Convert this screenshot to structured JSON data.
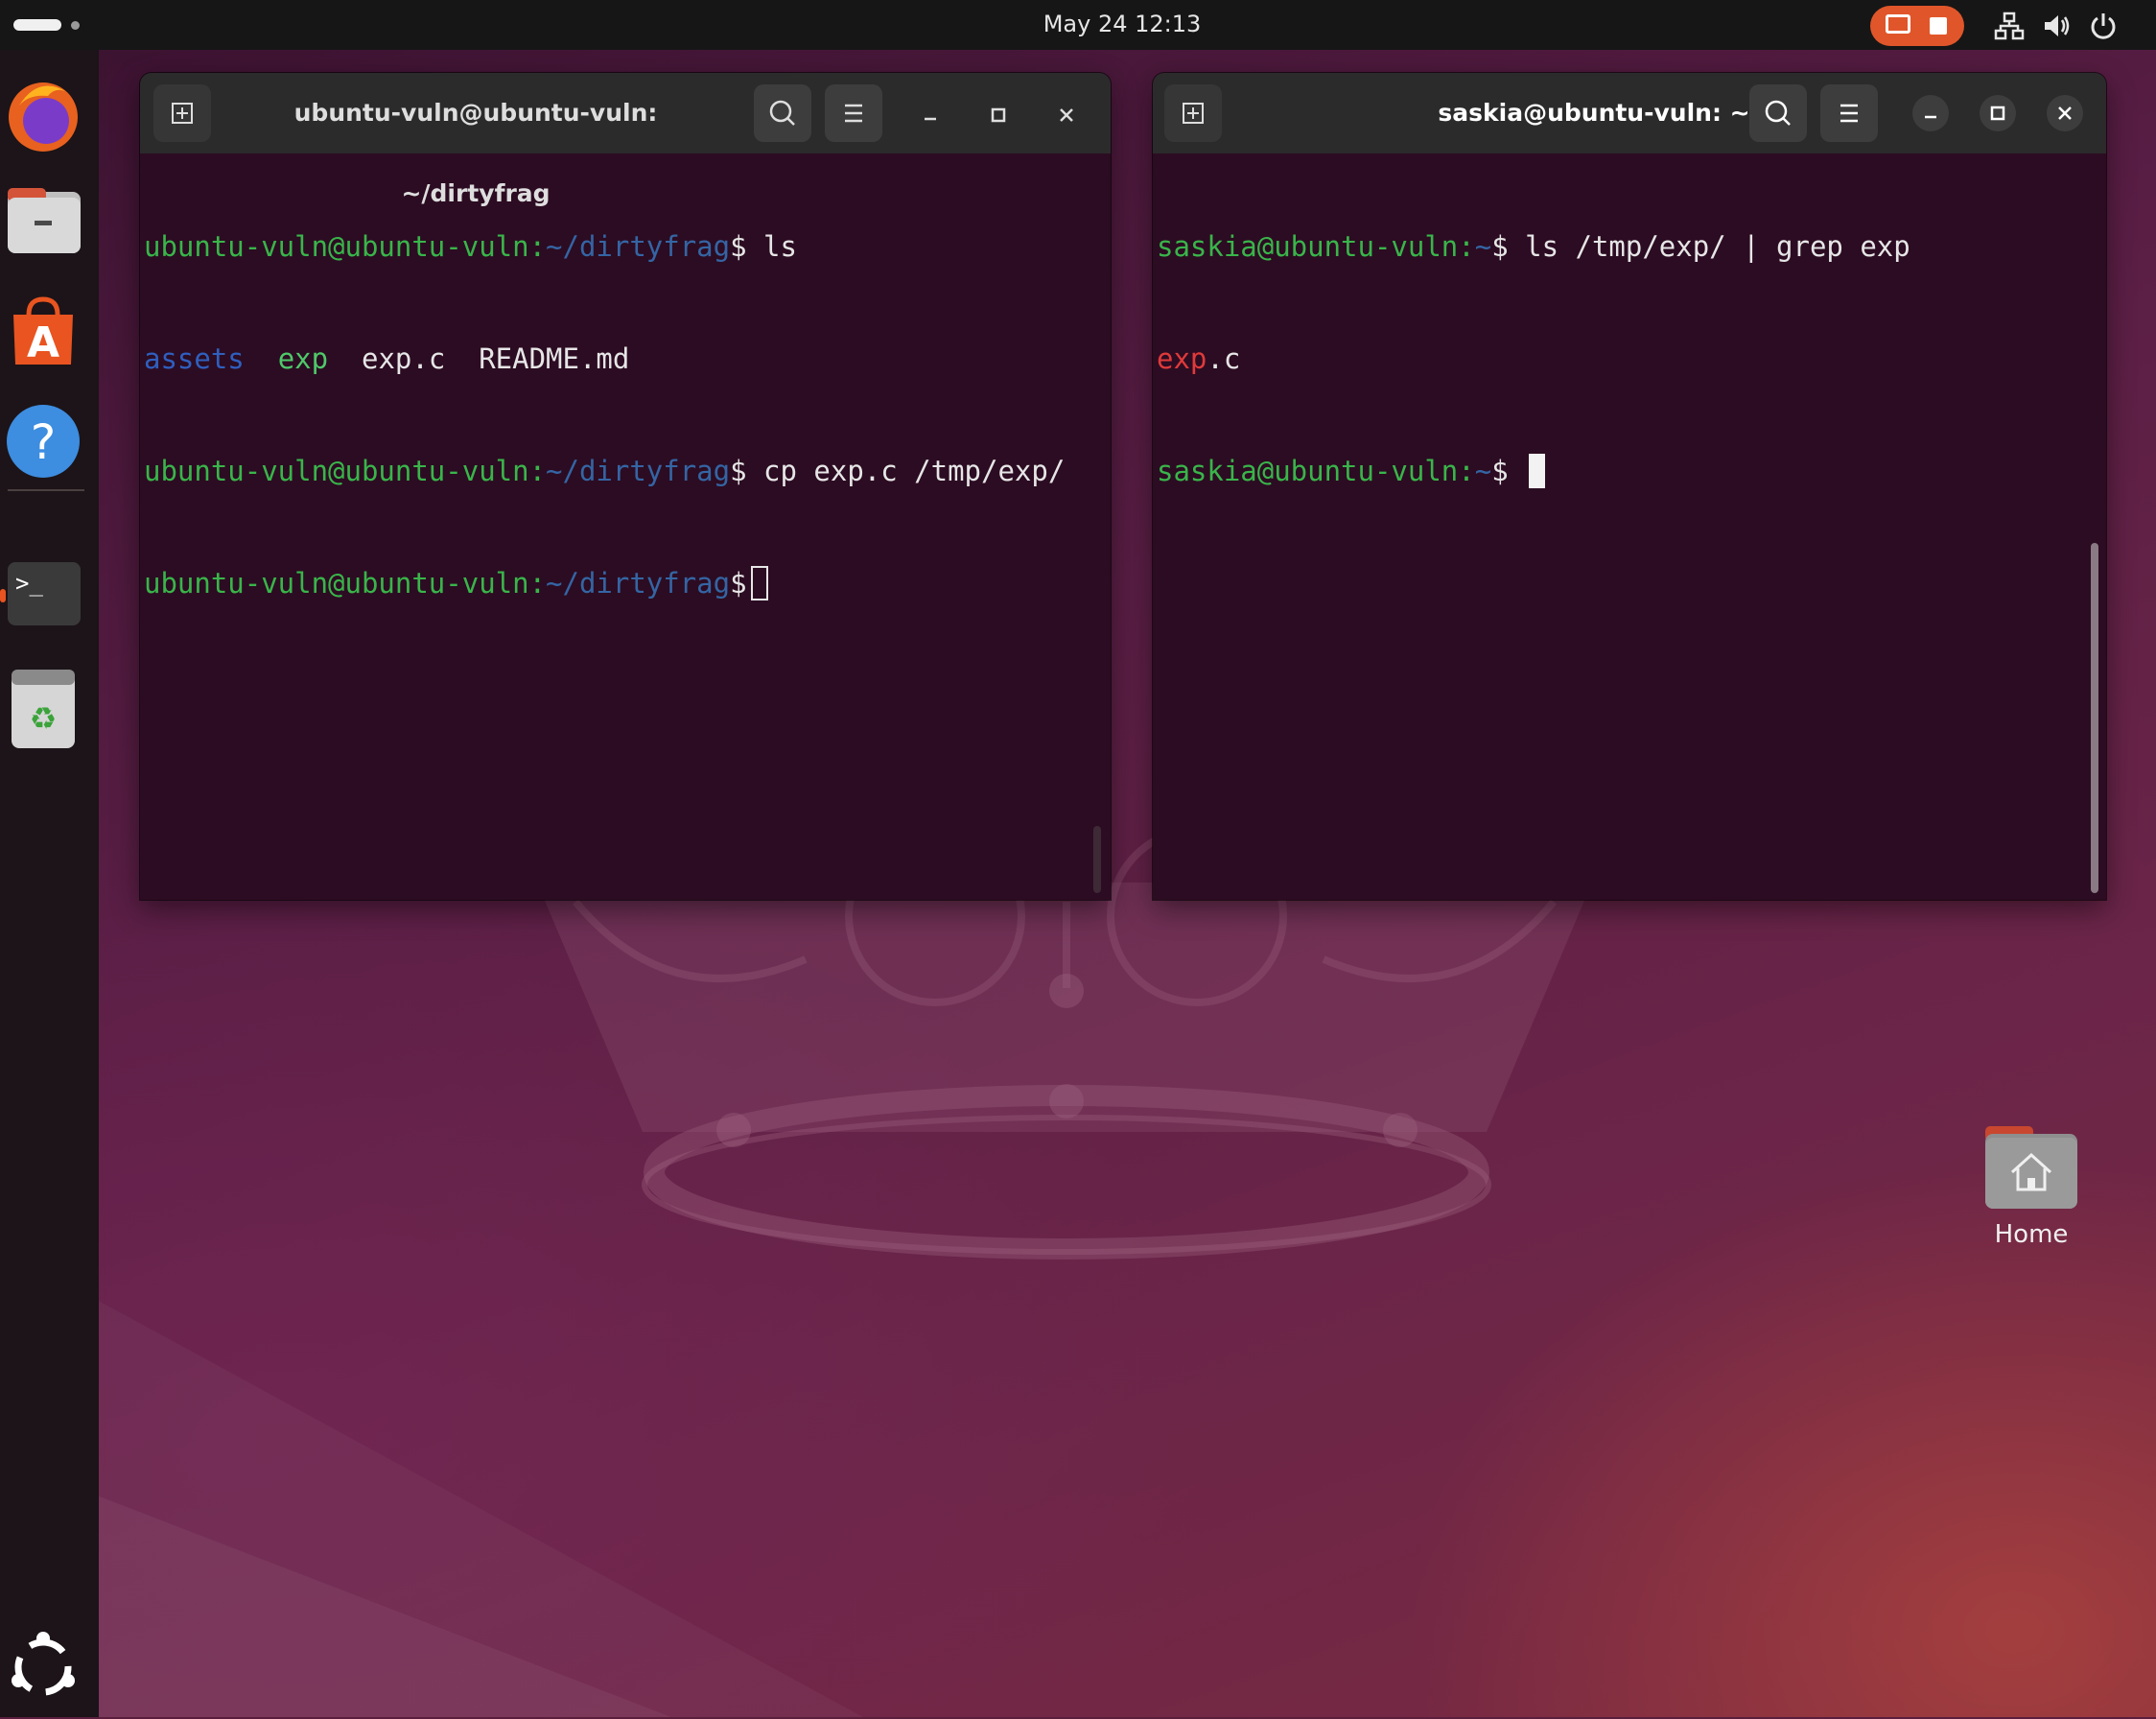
{
  "topbar": {
    "datetime": "May 24  12:13",
    "tray_icons": [
      "screen-record-icon",
      "stop-record-icon",
      "network-icon",
      "volume-icon",
      "power-icon"
    ],
    "record_color": "#e0562a"
  },
  "dock": {
    "items": [
      {
        "name": "firefox-icon"
      },
      {
        "name": "files-icon"
      },
      {
        "name": "app-center-icon"
      },
      {
        "name": "help-icon"
      },
      {
        "name": "terminal-icon"
      },
      {
        "name": "trash-icon"
      },
      {
        "name": "show-apps-icon"
      }
    ]
  },
  "terminal_left": {
    "title": "ubuntu-vuln@ubuntu-vuln: ~/dirtyfrag",
    "prompt_user": "ubuntu-vuln@ubuntu-vuln:",
    "prompt_path": "~/dirtyfrag",
    "prompt_sym": "$",
    "cmd1": " ls",
    "ls_dir": "assets",
    "ls_exe": "exp",
    "ls_files": "exp.c  README.md",
    "cmd2": " cp exp.c /tmp/exp/"
  },
  "terminal_right": {
    "title": "saskia@ubuntu-vuln: ~",
    "prompt_user": "saskia@ubuntu-vuln:",
    "prompt_path": "~",
    "prompt_sym": "$",
    "cmd1": " ls /tmp/exp/ | grep exp",
    "match": "exp",
    "rest": ".c"
  },
  "desktop": {
    "home_label": "Home"
  },
  "colors": {
    "prompt_green": "#39b54a",
    "path_blue": "#3465a4",
    "terminal_bg": "#2c0c22",
    "accent": "#e95420"
  }
}
